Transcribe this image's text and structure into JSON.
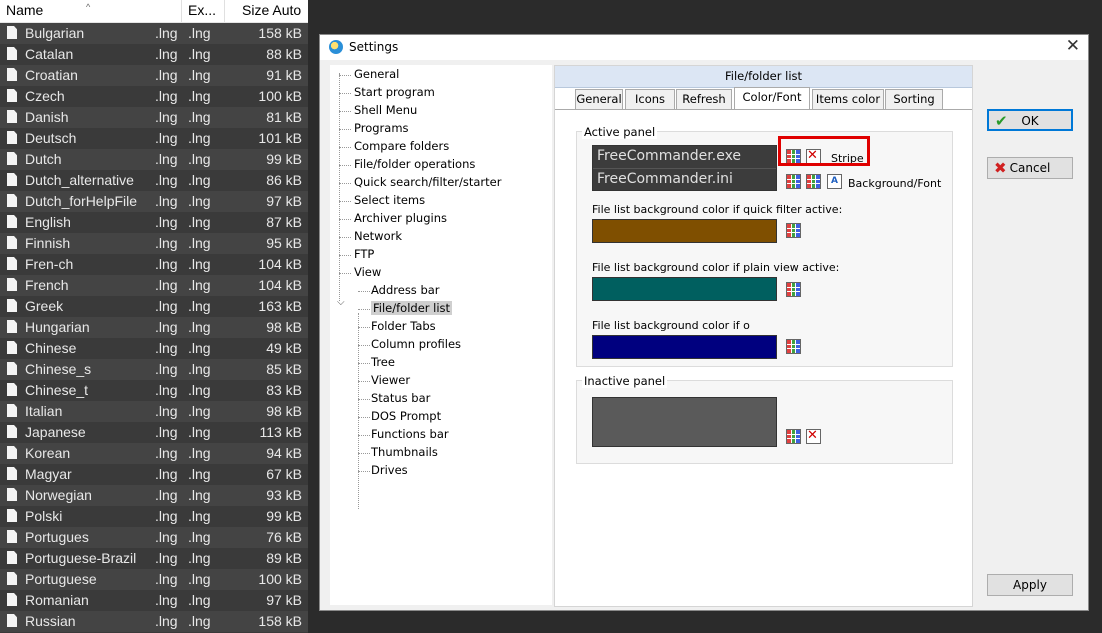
{
  "filelist": {
    "headers": {
      "name": "Name",
      "ext": "Ex...",
      "size": "Size Auto"
    },
    "rows": [
      {
        "name": "Bulgarian",
        "ext1": ".lng",
        "ext2": ".lng",
        "size": "158 kB"
      },
      {
        "name": "Catalan",
        "ext1": ".lng",
        "ext2": ".lng",
        "size": "88 kB"
      },
      {
        "name": "Croatian",
        "ext1": ".lng",
        "ext2": ".lng",
        "size": "91 kB"
      },
      {
        "name": "Czech",
        "ext1": ".lng",
        "ext2": ".lng",
        "size": "100 kB"
      },
      {
        "name": "Danish",
        "ext1": ".lng",
        "ext2": ".lng",
        "size": "81 kB"
      },
      {
        "name": "Deutsch",
        "ext1": ".lng",
        "ext2": ".lng",
        "size": "101 kB"
      },
      {
        "name": "Dutch",
        "ext1": ".lng",
        "ext2": ".lng",
        "size": "99 kB"
      },
      {
        "name": "Dutch_alternative",
        "ext1": ".lng",
        "ext2": ".lng",
        "size": "86 kB"
      },
      {
        "name": "Dutch_forHelpFile",
        "ext1": ".lng",
        "ext2": ".lng",
        "size": "97 kB"
      },
      {
        "name": "English",
        "ext1": ".lng",
        "ext2": ".lng",
        "size": "87 kB"
      },
      {
        "name": "Finnish",
        "ext1": ".lng",
        "ext2": ".lng",
        "size": "95 kB"
      },
      {
        "name": "Fren-ch",
        "ext1": ".lng",
        "ext2": ".lng",
        "size": "104 kB"
      },
      {
        "name": "French",
        "ext1": ".lng",
        "ext2": ".lng",
        "size": "104 kB"
      },
      {
        "name": "Greek",
        "ext1": ".lng",
        "ext2": ".lng",
        "size": "163 kB"
      },
      {
        "name": "Hungarian",
        "ext1": ".lng",
        "ext2": ".lng",
        "size": "98 kB"
      },
      {
        "name": "Chinese",
        "ext1": ".lng",
        "ext2": ".lng",
        "size": "49 kB"
      },
      {
        "name": "Chinese_s",
        "ext1": ".lng",
        "ext2": ".lng",
        "size": "85 kB"
      },
      {
        "name": "Chinese_t",
        "ext1": ".lng",
        "ext2": ".lng",
        "size": "83 kB"
      },
      {
        "name": "Italian",
        "ext1": ".lng",
        "ext2": ".lng",
        "size": "98 kB"
      },
      {
        "name": "Japanese",
        "ext1": ".lng",
        "ext2": ".lng",
        "size": "113 kB"
      },
      {
        "name": "Korean",
        "ext1": ".lng",
        "ext2": ".lng",
        "size": "94 kB"
      },
      {
        "name": "Magyar",
        "ext1": ".lng",
        "ext2": ".lng",
        "size": "67 kB"
      },
      {
        "name": "Norwegian",
        "ext1": ".lng",
        "ext2": ".lng",
        "size": "93 kB"
      },
      {
        "name": "Polski",
        "ext1": ".lng",
        "ext2": ".lng",
        "size": "99 kB"
      },
      {
        "name": "Portugues",
        "ext1": ".lng",
        "ext2": ".lng",
        "size": "76 kB"
      },
      {
        "name": "Portuguese-Brazil",
        "ext1": ".lng",
        "ext2": ".lng",
        "size": "89 kB"
      },
      {
        "name": "Portuguese",
        "ext1": ".lng",
        "ext2": ".lng",
        "size": "100 kB"
      },
      {
        "name": "Romanian",
        "ext1": ".lng",
        "ext2": ".lng",
        "size": "97 kB"
      },
      {
        "name": "Russian",
        "ext1": ".lng",
        "ext2": ".lng",
        "size": "158 kB"
      }
    ]
  },
  "dialog": {
    "title": "Settings",
    "close": "✕",
    "tree": [
      "General",
      "Start program",
      "Shell Menu",
      "Programs",
      "Compare folders",
      "File/folder operations",
      "Quick search/filter/starter",
      "Select items",
      "Archiver plugins",
      "Network",
      "FTP",
      "View"
    ],
    "tree_children": [
      "Address bar",
      "File/folder list",
      "Folder Tabs",
      "Column profiles",
      "Tree",
      "Viewer",
      "Status bar",
      "DOS Prompt",
      "Functions bar",
      "Thumbnails",
      "Drives"
    ],
    "selected": "File/folder list",
    "pane_title": "File/folder list",
    "tabs": [
      "General",
      "Icons",
      "Refresh",
      "Color/Font",
      "Items color",
      "Sorting"
    ],
    "active_tab": "Color/Font",
    "active_panel": {
      "label": "Active panel",
      "sample1": "FreeCommander.exe",
      "sample2": "FreeCommander.ini",
      "stripe": "Stripe",
      "bgfont": "Background/Font",
      "quick_filter_label": "File list background color if quick filter active:",
      "plain_view_label": "File list background color if plain view active:",
      "other_label": "File list background color if o",
      "colors": {
        "sample_bg": "#3c3c3c",
        "quick_filter": "#7f4f00",
        "plain_view": "#005f5f",
        "other": "#00007f"
      }
    },
    "inactive_panel": {
      "label": "Inactive panel",
      "color": "#5a5a5a"
    },
    "buttons": {
      "ok": "OK",
      "cancel": "Cancel",
      "apply": "Apply"
    }
  }
}
